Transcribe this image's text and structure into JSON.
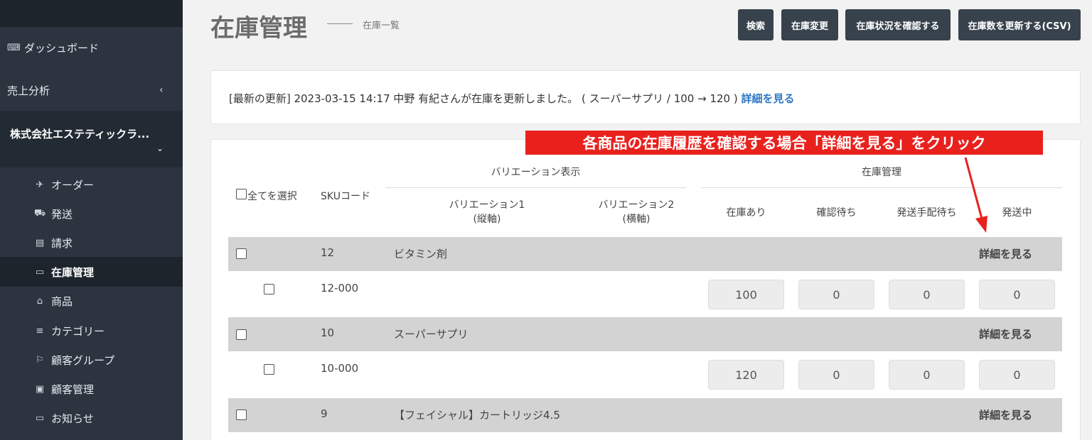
{
  "sidebar": {
    "dashboard": "ダッシュボード",
    "sales": "売上分析",
    "sales_chevron": "‹",
    "company": "株式会社エステティックラ...",
    "company_chevron": "⌄",
    "items": [
      {
        "label": "オーダー",
        "icon": "✈"
      },
      {
        "label": "発送",
        "icon": "⛟"
      },
      {
        "label": "請求",
        "icon": "▤"
      },
      {
        "label": "在庫管理",
        "icon": "▭"
      },
      {
        "label": "商品",
        "icon": "⌂"
      },
      {
        "label": "カテゴリー",
        "icon": "≡"
      },
      {
        "label": "顧客グループ",
        "icon": "⚐"
      },
      {
        "label": "顧客管理",
        "icon": "▣"
      },
      {
        "label": "お知らせ",
        "icon": "▭"
      }
    ]
  },
  "header": {
    "title": "在庫管理",
    "subtitle": "在庫一覧",
    "buttons": [
      "検索",
      "在庫変更",
      "在庫状況を確認する",
      "在庫数を更新する(CSV)"
    ]
  },
  "update": {
    "text": "[最新の更新] 2023-03-15 14:17 中野 有紀さんが在庫を更新しました。 ( スーパーサプリ / 100 → 120 ) ",
    "link": "詳細を見る"
  },
  "table": {
    "select_all": "全てを選択",
    "sku": "SKUコード",
    "variation_group": "バリエーション表示",
    "variation1": "バリエーション1",
    "variation1_sub": "(縦軸)",
    "variation2": "バリエーション2",
    "variation2_sub": "(横軸)",
    "stock_group": "在庫管理",
    "col_in_stock": "在庫あり",
    "col_confirm": "確認待ち",
    "col_arrange": "発送手配待ち",
    "col_shipping": "発送中",
    "products": [
      {
        "id": "12",
        "name": "ビタミン剤",
        "link": "詳細を見る",
        "sku": "12-000",
        "qty": [
          "100",
          "0",
          "0",
          "0"
        ]
      },
      {
        "id": "10",
        "name": "スーパーサプリ",
        "link": "詳細を見る",
        "sku": "10-000",
        "qty": [
          "120",
          "0",
          "0",
          "0"
        ]
      },
      {
        "id": "9",
        "name": "【フェイシャル】カートリッジ4.5",
        "link": "詳細を見る"
      }
    ]
  },
  "annotation": "各商品の在庫履歴を確認する場合「詳細を見る」をクリック",
  "colors": {
    "accent_link": "#2f78c4",
    "annotation": "#e8211d",
    "sidebar": "#2c3440"
  }
}
